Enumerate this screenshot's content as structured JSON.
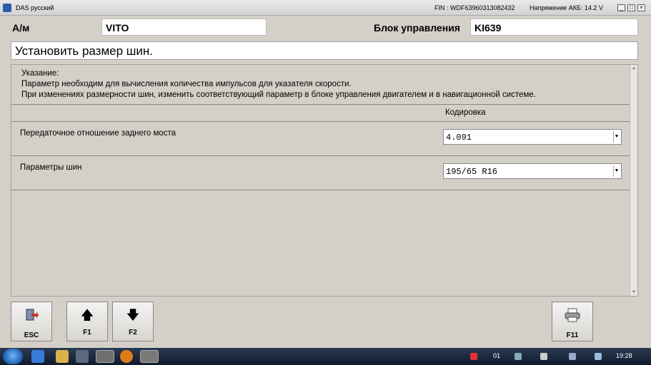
{
  "window": {
    "title": "DAS русский",
    "fin": "FIN : WDF63960313082432",
    "voltage": "Напряжение АКБ: 14.2 V",
    "minimize": "_",
    "restore": "□",
    "close": "×"
  },
  "header": {
    "vehicle_label": "А/м",
    "vehicle_value": "VITO",
    "ecu_label": "Блок управления",
    "ecu_value": "KI639"
  },
  "task_title": "Установить размер шин.",
  "note": {
    "heading": "Указание:",
    "line1": "Параметр необходим для вычисления количества импульсов для указателя скорости.",
    "line2": "При изменениях размерности шин, изменить соответствующий параметр в блоке управления двигателем и в навигационной системе."
  },
  "table": {
    "column_header": "Кодировка",
    "rows": [
      {
        "label": "Передаточное отношение заднего моста",
        "value": "4.091"
      },
      {
        "label": "Параметры шин",
        "value": "195/65 R16"
      }
    ]
  },
  "buttons": {
    "esc": "ESC",
    "f1": "F1",
    "f2": "F2",
    "f11": "F11"
  },
  "taskbar": {
    "clock": "19:28",
    "lang": "01"
  },
  "colors": {
    "panel": "#d4d0c8",
    "taskbar": "#16223a"
  }
}
